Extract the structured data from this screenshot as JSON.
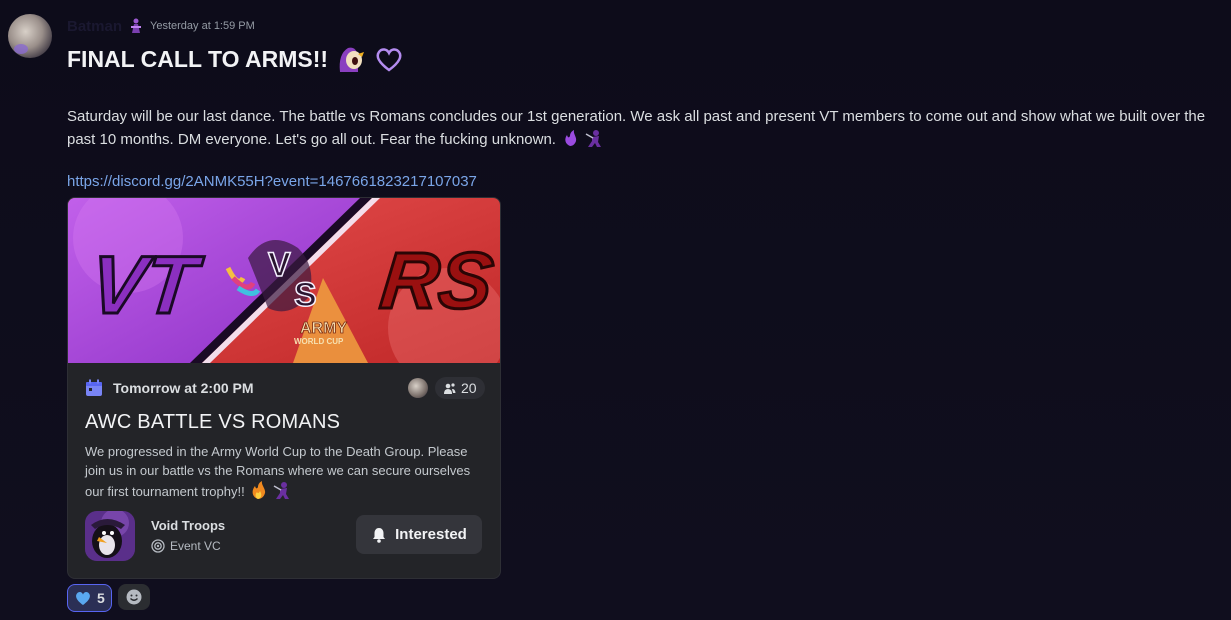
{
  "message": {
    "author": "Batman",
    "timestamp": "Yesterday at 1:59 PM",
    "title": "FINAL CALL TO ARMS!!",
    "body": "Saturday will be our last dance. The battle vs Romans concludes our 1st generation. We ask all past and present VT members to come out and show what we built over the past 10 months. DM everyone. Let's go all out. Fear the fucking unknown.",
    "link": "https://discord.gg/2ANMK55H?event=1467661823217107037"
  },
  "event": {
    "banner": {
      "left_team": "VT",
      "vs_v": "V",
      "vs_s": "S",
      "right_team": "RS",
      "army": "ARMY",
      "world_cup": "WORLD CUP"
    },
    "when": "Tomorrow at 2:00 PM",
    "interested_count": "20",
    "title": "AWC BATTLE VS ROMANS",
    "description": "We progressed in the Army World Cup to the Death Group. Please join us in our battle vs the Romans where we can secure ourselves our first tournament trophy!!",
    "server_name": "Void Troops",
    "channel": "Event VC",
    "interested_label": "Interested"
  },
  "reactions": [
    {
      "icon": "blue-heart-icon",
      "count": "5"
    }
  ],
  "colors": {
    "accent_purple": "#b45be0",
    "accent_red": "#e24040",
    "link": "#7aa5e8",
    "reaction_border": "#5865f2"
  }
}
